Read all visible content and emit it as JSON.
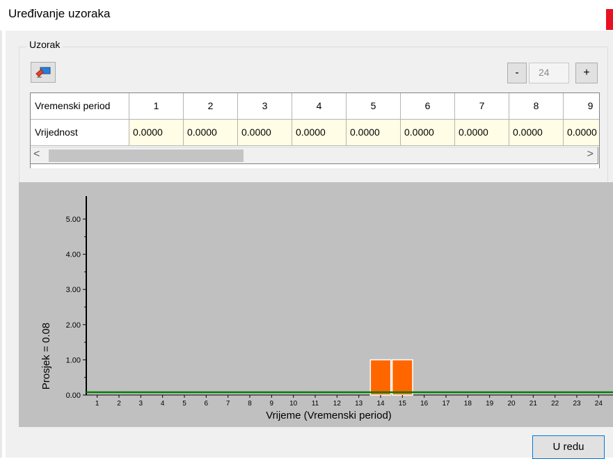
{
  "window": {
    "title": "Uređivanje uzoraka",
    "close_icon": "close-icon"
  },
  "group": {
    "label": "Uzorak"
  },
  "toolbar": {
    "tool_icon": "clear-sample-icon"
  },
  "count": {
    "minus_label": "-",
    "value": "24",
    "plus_label": "+"
  },
  "table": {
    "row_headers": [
      "Vremenski period",
      "Vrijednost"
    ],
    "periods": [
      "1",
      "2",
      "3",
      "4",
      "5",
      "6",
      "7",
      "8",
      "9"
    ],
    "values": [
      "0.0000",
      "0.0000",
      "0.0000",
      "0.0000",
      "0.0000",
      "0.0000",
      "0.0000",
      "0.0000",
      "0.0000"
    ]
  },
  "scrollbar": {
    "left_arrow": "<",
    "right_arrow": ">"
  },
  "chart_data": {
    "type": "bar",
    "categories": [
      "1",
      "2",
      "3",
      "4",
      "5",
      "6",
      "7",
      "8",
      "9",
      "10",
      "11",
      "12",
      "13",
      "14",
      "15",
      "16",
      "17",
      "18",
      "19",
      "20",
      "21",
      "22",
      "23",
      "24"
    ],
    "values": [
      0,
      0,
      0,
      0,
      0,
      0,
      0,
      0,
      0,
      0,
      0,
      0,
      0,
      1,
      1,
      0,
      0,
      0,
      0,
      0,
      0,
      0,
      0,
      0
    ],
    "ylabel": "Prosjek = 0.08",
    "xlabel": "Vrijeme (Vremenski period)",
    "y_ticks": [
      "0.00",
      "1.00",
      "2.00",
      "3.00",
      "4.00",
      "5.00"
    ],
    "ylim": [
      0,
      6
    ],
    "average": 0.08,
    "bar_color": "#ff6600",
    "average_line_color": "#008000",
    "background": "#c0c0c0"
  },
  "footer": {
    "ok_label": "U redu"
  }
}
